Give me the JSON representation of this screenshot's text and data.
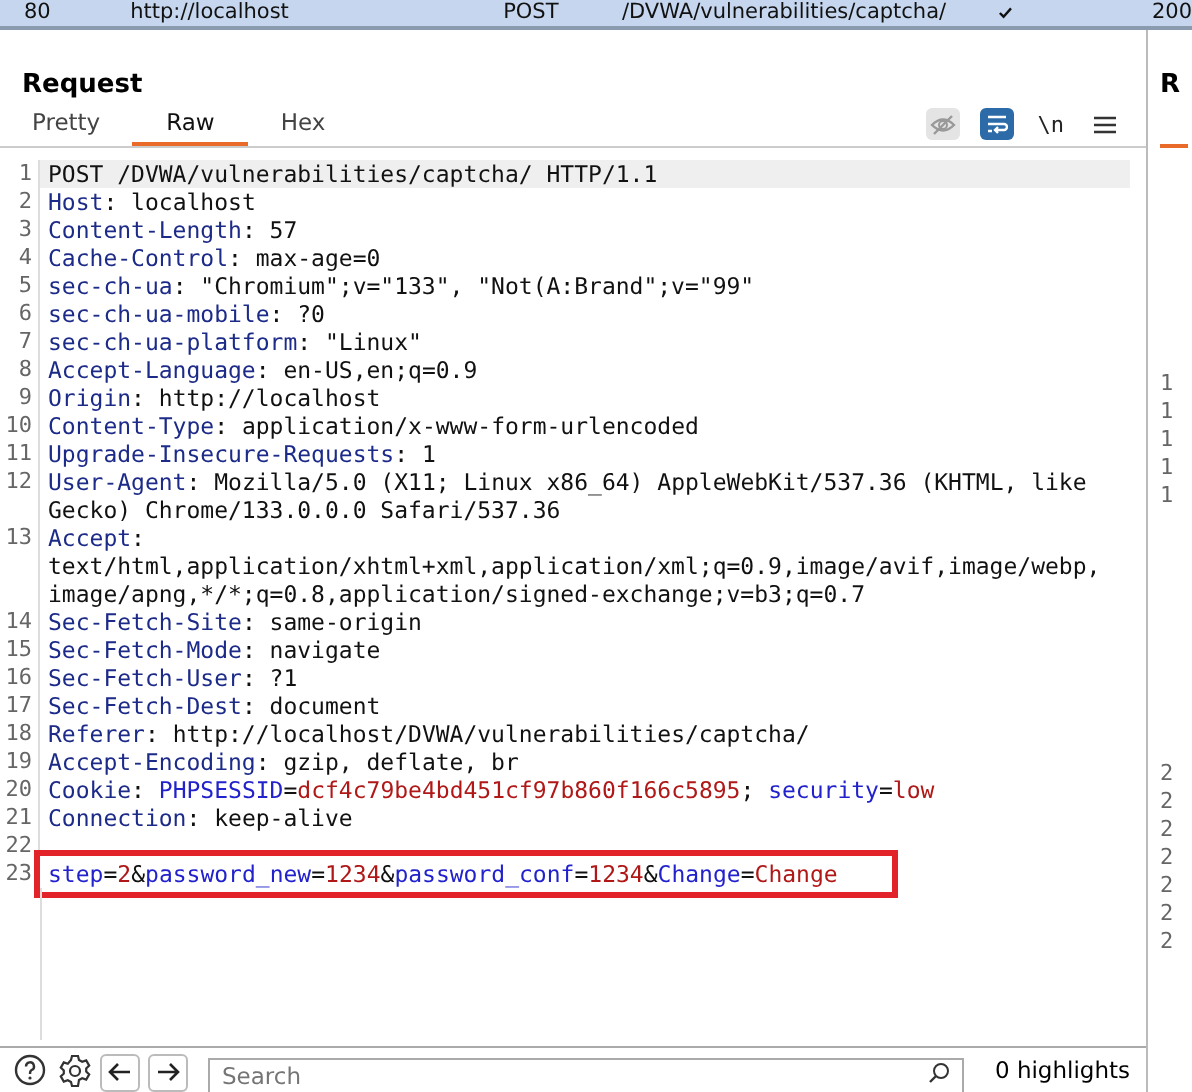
{
  "history_row": {
    "number": "80",
    "host": "http://localhost",
    "method": "POST",
    "url": "/DVWA/vulnerabilities/captcha/",
    "edited": true,
    "status": "200"
  },
  "request": {
    "title": "Request",
    "tabs": [
      {
        "label": "Pretty",
        "selected": false
      },
      {
        "label": "Raw",
        "selected": true
      },
      {
        "label": "Hex",
        "selected": false
      }
    ],
    "toolbar": {
      "hide_nonprinting_active": false,
      "wrap_active": true,
      "newline_label": "\\n"
    },
    "rows": [
      {
        "number": "1",
        "current": true,
        "segments": [
          {
            "kind": "text",
            "text": "POST /DVWA/vulnerabilities/captcha/ HTTP/1.1"
          }
        ]
      },
      {
        "number": "2",
        "segments": [
          {
            "kind": "header",
            "text": "Host"
          },
          {
            "kind": "text",
            "text": ": localhost"
          }
        ]
      },
      {
        "number": "3",
        "segments": [
          {
            "kind": "header",
            "text": "Content-Length"
          },
          {
            "kind": "text",
            "text": ": 57"
          }
        ]
      },
      {
        "number": "4",
        "segments": [
          {
            "kind": "header",
            "text": "Cache-Control"
          },
          {
            "kind": "text",
            "text": ": max-age=0"
          }
        ]
      },
      {
        "number": "5",
        "segments": [
          {
            "kind": "header",
            "text": "sec-ch-ua"
          },
          {
            "kind": "text",
            "text": ": \"Chromium\";v=\"133\", \"Not(A:Brand\";v=\"99\""
          }
        ]
      },
      {
        "number": "6",
        "segments": [
          {
            "kind": "header",
            "text": "sec-ch-ua-mobile"
          },
          {
            "kind": "text",
            "text": ": ?0"
          }
        ]
      },
      {
        "number": "7",
        "segments": [
          {
            "kind": "header",
            "text": "sec-ch-ua-platform"
          },
          {
            "kind": "text",
            "text": ": \"Linux\""
          }
        ]
      },
      {
        "number": "8",
        "segments": [
          {
            "kind": "header",
            "text": "Accept-Language"
          },
          {
            "kind": "text",
            "text": ": en-US,en;q=0.9"
          }
        ]
      },
      {
        "number": "9",
        "segments": [
          {
            "kind": "header",
            "text": "Origin"
          },
          {
            "kind": "text",
            "text": ": http://localhost"
          }
        ]
      },
      {
        "number": "10",
        "segments": [
          {
            "kind": "header",
            "text": "Content-Type"
          },
          {
            "kind": "text",
            "text": ": application/x-www-form-urlencoded"
          }
        ]
      },
      {
        "number": "11",
        "segments": [
          {
            "kind": "header",
            "text": "Upgrade-Insecure-Requests"
          },
          {
            "kind": "text",
            "text": ": 1"
          }
        ]
      },
      {
        "number": "12",
        "segments": [
          {
            "kind": "header",
            "text": "User-Agent"
          },
          {
            "kind": "text",
            "text": ": Mozilla/5.0 (X11; Linux x86_64) AppleWebKit/537.36 (KHTML, like"
          }
        ]
      },
      {
        "segments": [
          {
            "kind": "text",
            "text": "Gecko) Chrome/133.0.0.0 Safari/537.36"
          }
        ]
      },
      {
        "number": "13",
        "segments": [
          {
            "kind": "header",
            "text": "Accept"
          },
          {
            "kind": "text",
            "text": ":"
          }
        ]
      },
      {
        "segments": [
          {
            "kind": "text",
            "text": "text/html,application/xhtml+xml,application/xml;q=0.9,image/avif,image/webp,"
          }
        ]
      },
      {
        "segments": [
          {
            "kind": "text",
            "text": "image/apng,*/*;q=0.8,application/signed-exchange;v=b3;q=0.7"
          }
        ]
      },
      {
        "number": "14",
        "segments": [
          {
            "kind": "header",
            "text": "Sec-Fetch-Site"
          },
          {
            "kind": "text",
            "text": ": same-origin"
          }
        ]
      },
      {
        "number": "15",
        "segments": [
          {
            "kind": "header",
            "text": "Sec-Fetch-Mode"
          },
          {
            "kind": "text",
            "text": ": navigate"
          }
        ]
      },
      {
        "number": "16",
        "segments": [
          {
            "kind": "header",
            "text": "Sec-Fetch-User"
          },
          {
            "kind": "text",
            "text": ": ?1"
          }
        ]
      },
      {
        "number": "17",
        "segments": [
          {
            "kind": "header",
            "text": "Sec-Fetch-Dest"
          },
          {
            "kind": "text",
            "text": ": document"
          }
        ]
      },
      {
        "number": "18",
        "segments": [
          {
            "kind": "header",
            "text": "Referer"
          },
          {
            "kind": "text",
            "text": ": http://localhost/DVWA/vulnerabilities/captcha/"
          }
        ]
      },
      {
        "number": "19",
        "segments": [
          {
            "kind": "header",
            "text": "Accept-Encoding"
          },
          {
            "kind": "text",
            "text": ": gzip, deflate, br"
          }
        ]
      },
      {
        "number": "20",
        "segments": [
          {
            "kind": "header",
            "text": "Cookie"
          },
          {
            "kind": "text",
            "text": ": "
          },
          {
            "kind": "param",
            "text": "PHPSESSID"
          },
          {
            "kind": "text",
            "text": "="
          },
          {
            "kind": "value",
            "text": "dcf4c79be4bd451cf97b860f166c5895"
          },
          {
            "kind": "text",
            "text": "; "
          },
          {
            "kind": "param",
            "text": "security"
          },
          {
            "kind": "text",
            "text": "="
          },
          {
            "kind": "value",
            "text": "low"
          }
        ]
      },
      {
        "number": "21",
        "segments": [
          {
            "kind": "header",
            "text": "Connection"
          },
          {
            "kind": "text",
            "text": ": keep-alive"
          }
        ]
      },
      {
        "number": "22",
        "segments": []
      },
      {
        "number": "23",
        "boxed": true,
        "segments": [
          {
            "kind": "param",
            "text": "step"
          },
          {
            "kind": "text",
            "text": "="
          },
          {
            "kind": "value",
            "text": "2"
          },
          {
            "kind": "text",
            "text": "&"
          },
          {
            "kind": "param",
            "text": "password_new"
          },
          {
            "kind": "text",
            "text": "="
          },
          {
            "kind": "value",
            "text": "1234"
          },
          {
            "kind": "text",
            "text": "&"
          },
          {
            "kind": "param",
            "text": "password_conf"
          },
          {
            "kind": "text",
            "text": "="
          },
          {
            "kind": "value",
            "text": "1234"
          },
          {
            "kind": "text",
            "text": "&"
          },
          {
            "kind": "param",
            "text": "Change"
          },
          {
            "kind": "text",
            "text": "="
          },
          {
            "kind": "value",
            "text": "Change"
          }
        ]
      }
    ],
    "search": {
      "placeholder": "Search"
    },
    "highlights": "0 highlights"
  },
  "response": {
    "title": "R",
    "line_numbers": [
      "1",
      "1",
      "1",
      "1",
      "1",
      "2",
      "2",
      "2",
      "2",
      "2",
      "2",
      "2"
    ]
  }
}
